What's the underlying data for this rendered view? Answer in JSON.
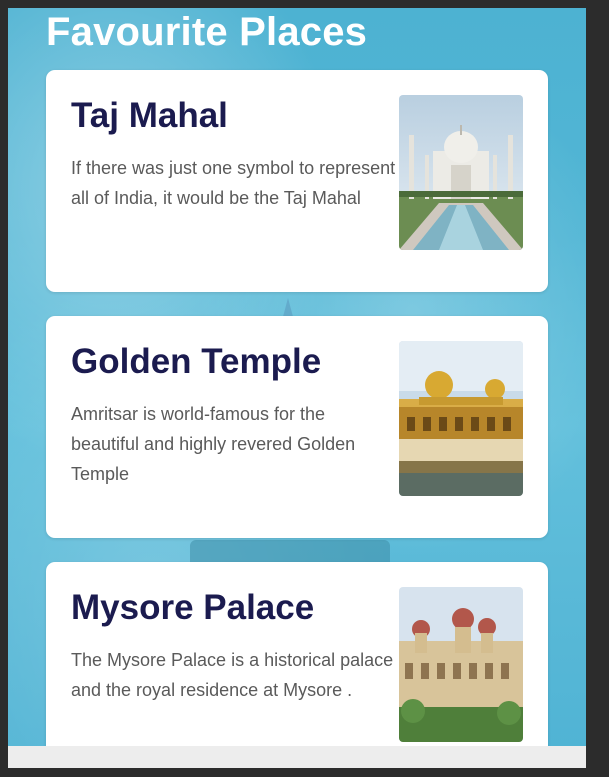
{
  "page": {
    "title": "Favourite Places"
  },
  "places": [
    {
      "title": "Taj Mahal",
      "description": "If there was just one symbol to represent all of India, it would be the Taj Mahal",
      "image_icon": "taj-mahal-image"
    },
    {
      "title": "Golden Temple",
      "description": "Amritsar is world-famous for the beautiful and highly revered Golden Temple",
      "image_icon": "golden-temple-image"
    },
    {
      "title": "Mysore Palace",
      "description": "The Mysore Palace is a historical palace and the royal residence at Mysore .",
      "image_icon": "mysore-palace-image"
    }
  ],
  "colors": {
    "background": "#52b6d5",
    "card": "#ffffff",
    "title_text": "#1b1b4f",
    "body_text": "#5a5a5a"
  }
}
